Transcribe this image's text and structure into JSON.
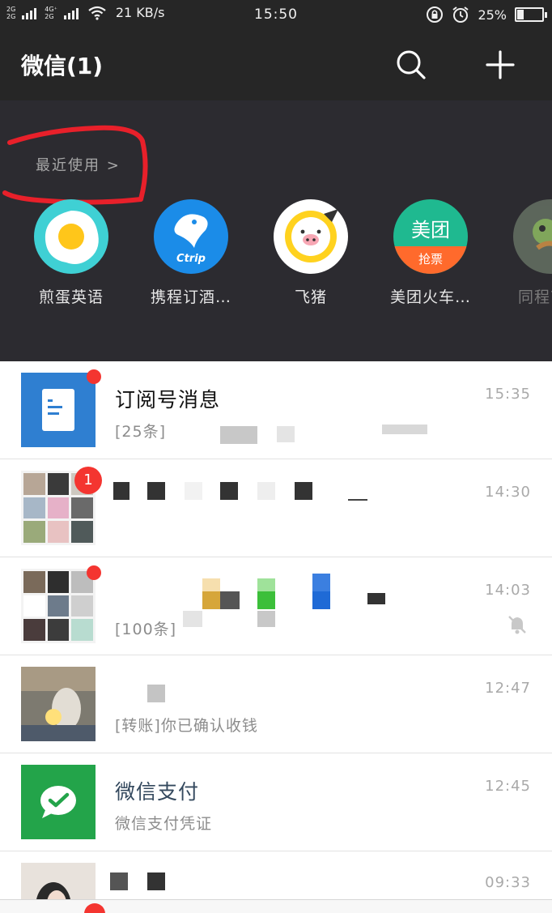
{
  "status_bar": {
    "sim_top": "2G",
    "sim_bottom": "2G",
    "net_top": "4G⁺",
    "net_bottom": "2G",
    "speed": "21 KB/s",
    "time": "15:50",
    "battery": "25%",
    "battery_level": 0.25
  },
  "header": {
    "title": "微信(1)",
    "search_icon": "search-icon",
    "add_icon": "plus-icon"
  },
  "mini_programs": {
    "recent_label": "最近使用 >",
    "apps": [
      {
        "label": "煎蛋英语",
        "icon": "egg-icon"
      },
      {
        "label": "携程订酒…",
        "icon": "ctrip-dolphin-icon",
        "icon_text": "Ctrip"
      },
      {
        "label": "飞猪",
        "icon": "fliggy-pig-icon"
      },
      {
        "label": "美团火车…",
        "icon": "meituan-icon",
        "icon_text_top": "美团",
        "icon_text_bottom": "抢票"
      },
      {
        "label": "同程艺…",
        "icon": "tongcheng-icon"
      }
    ]
  },
  "chats": [
    {
      "name": "订阅号消息",
      "preview": "[25条]",
      "time": "15:35",
      "unread_dot": true
    },
    {
      "name": "",
      "preview": "",
      "time": "14:30",
      "unread_count": "1"
    },
    {
      "name": "",
      "preview": "[100条]",
      "time": "14:03",
      "unread_dot": true,
      "muted": true
    },
    {
      "name": "",
      "preview": "[转账]你已确认收钱",
      "time": "12:47"
    },
    {
      "name": "微信支付",
      "preview": "微信支付凭证",
      "time": "12:45"
    },
    {
      "name": "",
      "preview": "",
      "time": "09:33"
    }
  ],
  "colors": {
    "header_bg": "#262626",
    "panel_bg": "#2c2b30",
    "badge_red": "#f43530",
    "wechat_green": "#1aad19",
    "subscription_blue": "#2f7fd1",
    "annotation_red": "#e8202a"
  }
}
